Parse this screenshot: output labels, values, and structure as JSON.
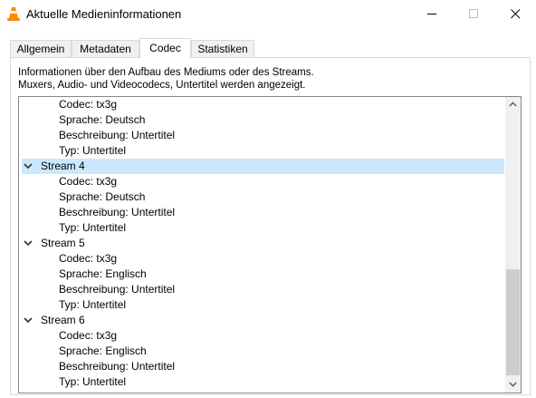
{
  "window": {
    "title": "Aktuelle Medieninformationen",
    "icon": "vlc-cone-icon",
    "controls": [
      "minimize-icon",
      "maximize-icon",
      "close-icon"
    ]
  },
  "tabs": [
    {
      "label": "Allgemein",
      "active": false
    },
    {
      "label": "Metadaten",
      "active": false
    },
    {
      "label": "Codec",
      "active": true
    },
    {
      "label": "Statistiken",
      "active": false
    }
  ],
  "description": {
    "line1": "Informationen über den Aufbau des Mediums oder des Streams.",
    "line2": "Muxers, Audio- und Videocodecs, Untertitel werden angezeigt."
  },
  "tree": {
    "partial_stream": {
      "codec": "Codec: tx3g",
      "language": "Sprache: Deutsch",
      "description": "Beschreibung: Untertitel",
      "type": "Typ: Untertitel"
    },
    "streams": [
      {
        "label": "Stream 4",
        "selected": true,
        "codec": "Codec: tx3g",
        "language": "Sprache: Deutsch",
        "description": "Beschreibung: Untertitel",
        "type": "Typ: Untertitel"
      },
      {
        "label": "Stream 5",
        "selected": false,
        "codec": "Codec: tx3g",
        "language": "Sprache: Englisch",
        "description": "Beschreibung: Untertitel",
        "type": "Typ: Untertitel"
      },
      {
        "label": "Stream 6",
        "selected": false,
        "codec": "Codec: tx3g",
        "language": "Sprache: Englisch",
        "description": "Beschreibung: Untertitel",
        "type": "Typ: Untertitel"
      }
    ]
  },
  "colors": {
    "selection": "#cce8ff",
    "border": "#d9d9d9",
    "scrollbar_thumb": "#cdcdcd"
  }
}
